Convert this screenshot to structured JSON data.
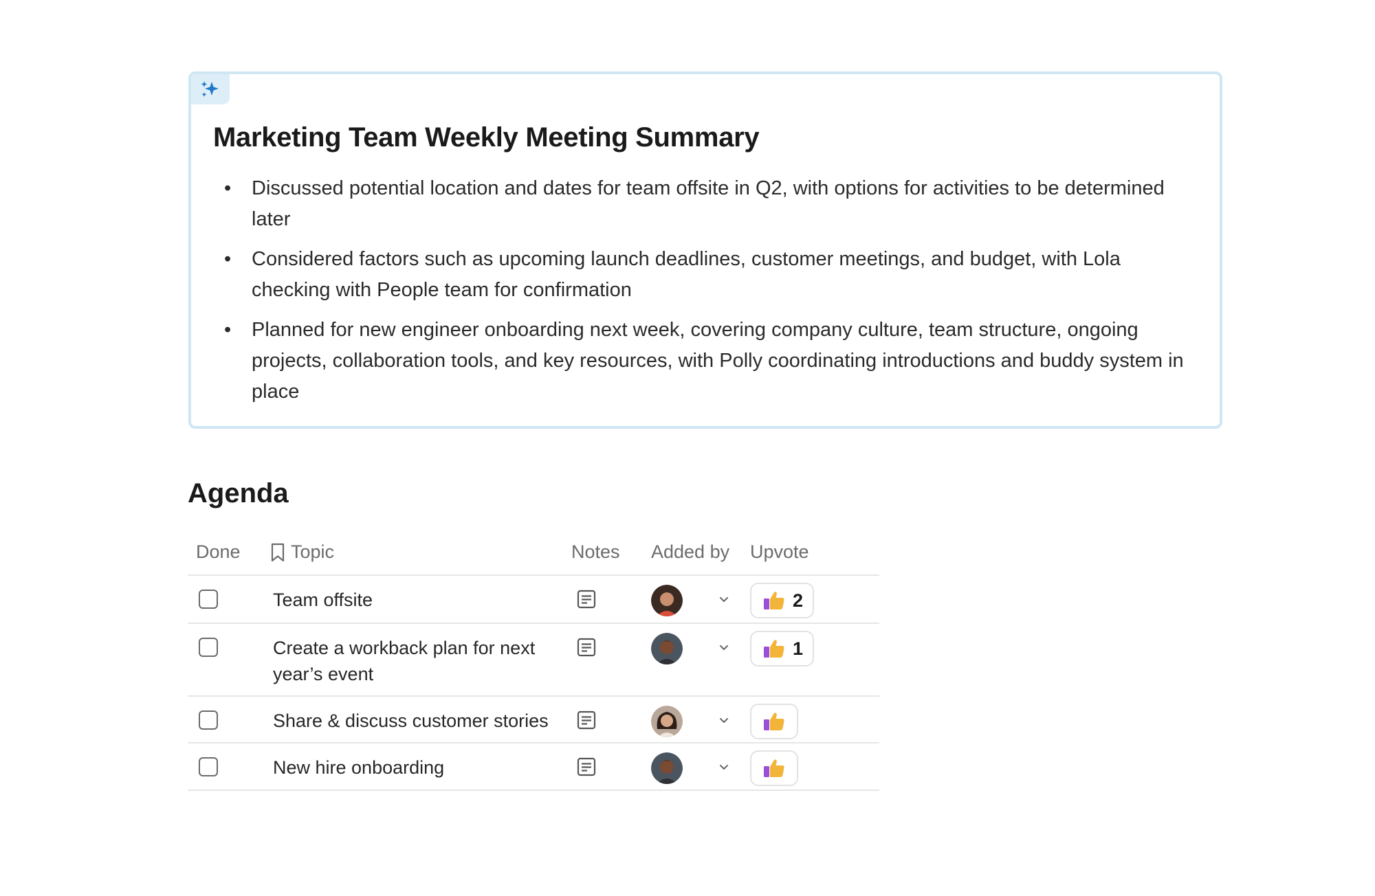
{
  "summary": {
    "title": "Marketing Team Weekly Meeting Summary",
    "badge_icon": "sparkles-icon",
    "bullets": [
      "Discussed potential location and dates for team offsite in Q2, with options for activities to be determined later",
      "Considered factors such as upcoming launch deadlines, customer meetings, and budget, with Lola checking with People team for confirmation",
      "Planned for new engineer onboarding next week, covering company culture, team structure, ongoing projects, collaboration tools, and key resources, with Polly coordinating introductions and buddy system in place"
    ]
  },
  "agenda": {
    "title": "Agenda",
    "columns": {
      "done": "Done",
      "topic": "Topic",
      "notes": "Notes",
      "added_by": "Added by",
      "upvote": "Upvote"
    },
    "rows": [
      {
        "topic": "Team offsite",
        "upvotes": "2",
        "done": false
      },
      {
        "topic": "Create a workback plan for next year’s event",
        "upvotes": "1",
        "done": false
      },
      {
        "topic": "Share & discuss customer stories",
        "upvotes": "",
        "done": false
      },
      {
        "topic": "New hire onboarding",
        "upvotes": "",
        "done": false
      }
    ]
  },
  "colors": {
    "card_border": "#cfe6f3",
    "badge_bg": "#deeef8",
    "sparkle": "#1f78c8",
    "thumb_yellow": "#f3b43a",
    "thumb_purple": "#9b4fd6"
  }
}
